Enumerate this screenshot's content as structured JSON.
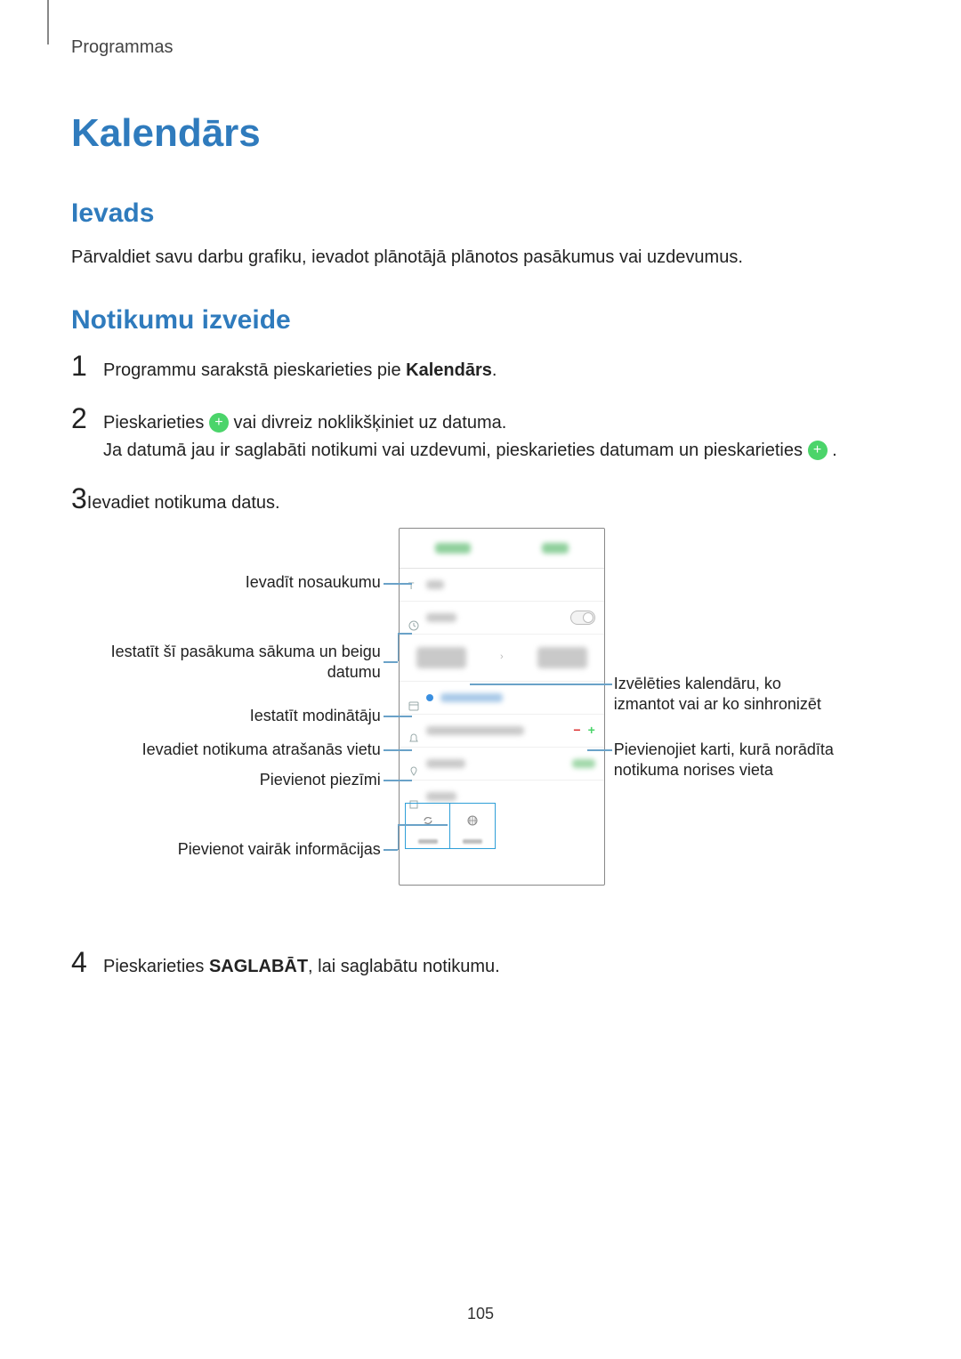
{
  "breadcrumb": "Programmas",
  "h1": "Kalendārs",
  "section_intro": {
    "heading": "Ievads",
    "text": "Pārvaldiet savu darbu grafiku, ievadot plānotājā plānotos pasākumus vai uzdevumus."
  },
  "section_create": {
    "heading": "Notikumu izveide",
    "steps": {
      "s1": {
        "num": "1",
        "pre": "Programmu sarakstā pieskarieties pie ",
        "bold": "Kalendārs",
        "post": "."
      },
      "s2": {
        "num": "2",
        "line1_pre": "Pieskarieties ",
        "line1_post": " vai divreiz noklikšķiniet uz datuma.",
        "line2_pre": "Ja datumā jau ir saglabāti notikumi vai uzdevumi, pieskarieties datumam un pieskarieties ",
        "line2_post": "."
      },
      "s3": {
        "num": "3",
        "text": "Ievadiet notikuma datus."
      },
      "s4": {
        "num": "4",
        "pre": "Pieskarieties ",
        "bold": "SAGLABĀT",
        "post": ", lai saglabātu notikumu."
      }
    }
  },
  "callouts": {
    "l_title": "Ievadīt nosaukumu",
    "l_dates": "Iestatīt šī pasākuma sākuma un beigu datumu",
    "l_alarm": "Iestatīt modinātāju",
    "l_location": "Ievadiet notikuma atrašanās vietu",
    "l_note": "Pievienot piezīmi",
    "l_more": "Pievienot vairāk informācijas",
    "r_calendar": "Izvēlēties kalendāru, ko izmantot vai ar ko sinhronizēt",
    "r_map": "Pievienojiet karti, kurā norādīta notikuma norises vieta"
  },
  "page_number": "105"
}
